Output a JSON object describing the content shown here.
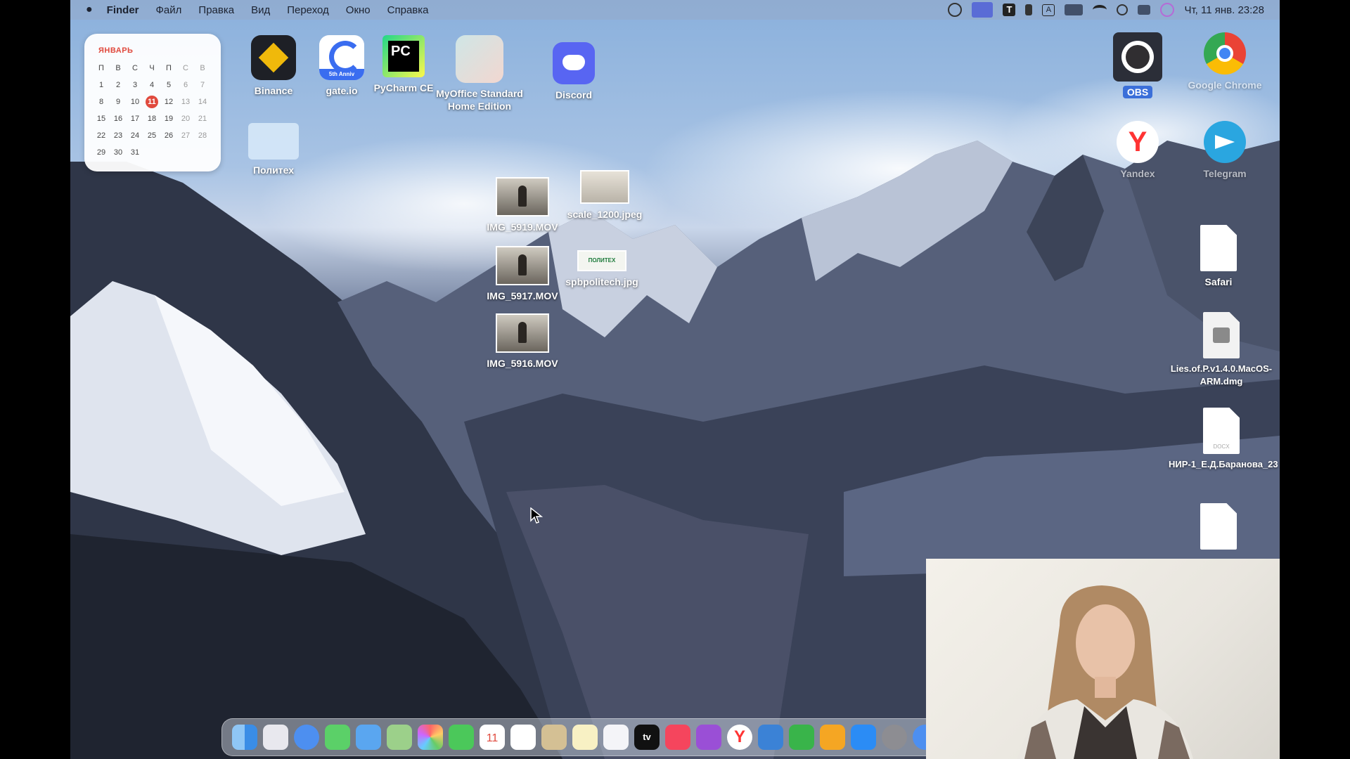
{
  "menubar": {
    "app": "Finder",
    "items": [
      "Файл",
      "Правка",
      "Вид",
      "Переход",
      "Окно",
      "Справка"
    ],
    "clock": "Чт, 11 янв. 23:28",
    "status_icons": [
      "screen-mirror-icon",
      "display-icon",
      "text-tool-icon",
      "bluetooth-icon",
      "input-source-icon",
      "keyboard-layout-icon",
      "wifi-icon",
      "search-icon",
      "control-center-icon",
      "siri-icon"
    ]
  },
  "calendar": {
    "month": "ЯНВАРЬ",
    "weekdays": [
      "П",
      "В",
      "С",
      "Ч",
      "П",
      "С",
      "В"
    ],
    "days": [
      "1",
      "2",
      "3",
      "4",
      "5",
      "6",
      "7",
      "8",
      "9",
      "10",
      "11",
      "12",
      "13",
      "14",
      "15",
      "16",
      "17",
      "18",
      "19",
      "20",
      "21",
      "22",
      "23",
      "24",
      "25",
      "26",
      "27",
      "28",
      "29",
      "30",
      "31"
    ],
    "today": "11"
  },
  "desktop": {
    "binance": "Binance",
    "gate": "gate.io",
    "gate_badge": "5th Anniv",
    "pycharm": "PyCharm CE",
    "pycharm_logo": "PC",
    "myoffice": "MyOffice Standard Home Edition",
    "discord": "Discord",
    "folder": "Политех",
    "img5919": "IMG_5919.MOV",
    "img5917": "IMG_5917.MOV",
    "img5916": "IMG_5916.MOV",
    "scale": "scale_1200.jpeg",
    "spb": "spbpolitech.jpg",
    "spb_logo": "ПОЛИТЕХ",
    "obs": "OBS",
    "chrome": "Google Chrome",
    "yandex": "Yandex",
    "telegram": "Telegram",
    "safari": "Safari",
    "dmg": "Lies.of.P.v1.4.0.MacOS-ARM.dmg",
    "docx": "НИР-1_Е.Д.Баранова_23",
    "docx_ext": "DOCX"
  },
  "dock": {
    "apps": [
      "finder-icon",
      "launchpad-icon",
      "safari-icon",
      "messages-icon",
      "mail-icon",
      "maps-icon",
      "photos-icon",
      "facetime-icon",
      "calendar-icon",
      "reminders-icon",
      "notes-icon",
      "stickies-icon",
      "freeform-icon",
      "tv-icon",
      "music-icon",
      "podcasts-icon",
      "yandex-icon",
      "keynote-icon",
      "numbers-icon",
      "pages-icon",
      "app-store-icon",
      "system-settings-icon",
      "safari-alt-icon"
    ],
    "calendar_date": "11",
    "tv_label": "tv"
  },
  "colors": {
    "calendar_accent": "#e0493d",
    "binance": "#f0b90b",
    "discord": "#5865f2",
    "telegram": "#2aa6e0"
  }
}
